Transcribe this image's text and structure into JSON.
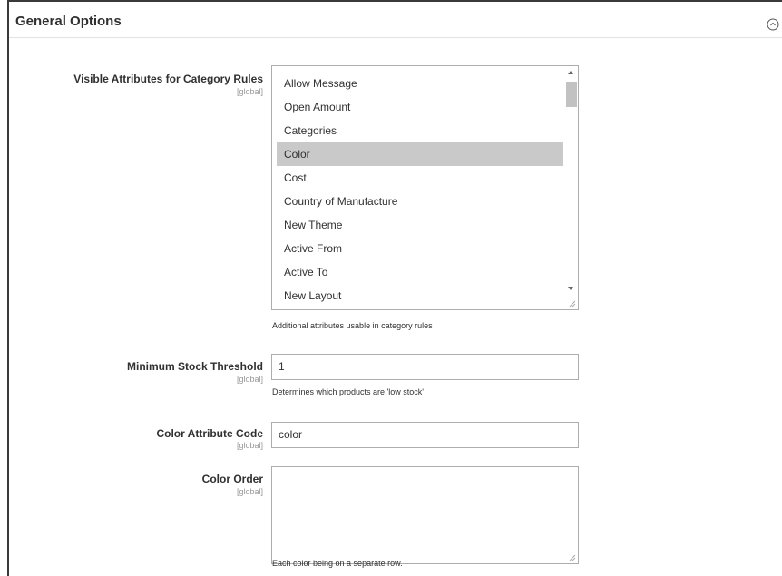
{
  "section": {
    "title": "General Options",
    "collapse_icon": "collapse-circle-icon"
  },
  "fields": {
    "visible_attributes": {
      "label": "Visible Attributes for Category Rules",
      "scope": "[global]",
      "options": [
        "Allow Message",
        "Open Amount",
        "Categories",
        "Color",
        "Cost",
        "Country of Manufacture",
        "New Theme",
        "Active From",
        "Active To",
        "New Layout"
      ],
      "selected": "Color",
      "note": "Additional attributes usable in category rules"
    },
    "min_stock": {
      "label": "Minimum Stock Threshold",
      "scope": "[global]",
      "value": "1",
      "note": "Determines which products are 'low stock'"
    },
    "color_attribute_code": {
      "label": "Color Attribute Code",
      "scope": "[global]",
      "value": "color"
    },
    "color_order": {
      "label": "Color Order",
      "scope": "[global]",
      "value": "",
      "note": "Each color being on a separate row."
    }
  }
}
